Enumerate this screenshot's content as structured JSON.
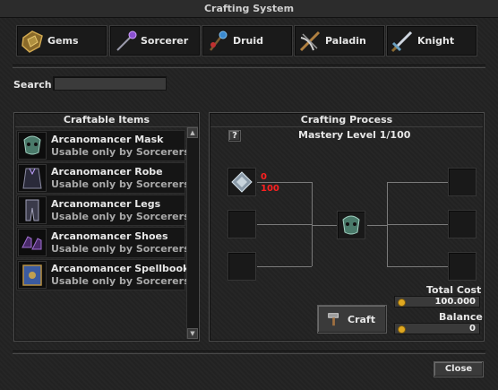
{
  "window": {
    "title": "Crafting System"
  },
  "tabs": [
    {
      "label": "Gems",
      "icon": "gem-shield-icon"
    },
    {
      "label": "Sorcerer",
      "icon": "wand-icon"
    },
    {
      "label": "Druid",
      "icon": "rod-icon"
    },
    {
      "label": "Paladin",
      "icon": "crossbow-icon"
    },
    {
      "label": "Knight",
      "icon": "sword-icon"
    }
  ],
  "search": {
    "label": "Search",
    "value": ""
  },
  "craftable": {
    "title": "Craftable Items",
    "items": [
      {
        "name": "Arcanomancer Mask",
        "sub": "Usable only by Sorcerers",
        "icon": "mask-icon"
      },
      {
        "name": "Arcanomancer Robe",
        "sub": "Usable only by Sorcerers",
        "icon": "robe-icon"
      },
      {
        "name": "Arcanomancer Legs",
        "sub": "Usable only by Sorcerers",
        "icon": "legs-icon"
      },
      {
        "name": "Arcanomancer Shoes",
        "sub": "Usable only by Sorcerers",
        "icon": "shoes-icon"
      },
      {
        "name": "Arcanomancer Spellbook",
        "sub": "Usable only by Sorcerers",
        "icon": "spellbook-icon"
      }
    ]
  },
  "process": {
    "title": "Crafting Process",
    "help": "?",
    "mastery": "Mastery Level 1/100",
    "ingredient_have": "0",
    "ingredient_need": "100",
    "craft_label": "Craft",
    "total_cost_label": "Total Cost",
    "total_cost": "100.000",
    "balance_label": "Balance",
    "balance": "0"
  },
  "footer": {
    "close_label": "Close"
  },
  "colors": {
    "need": "#ff2020",
    "coin": "#e0a820"
  }
}
